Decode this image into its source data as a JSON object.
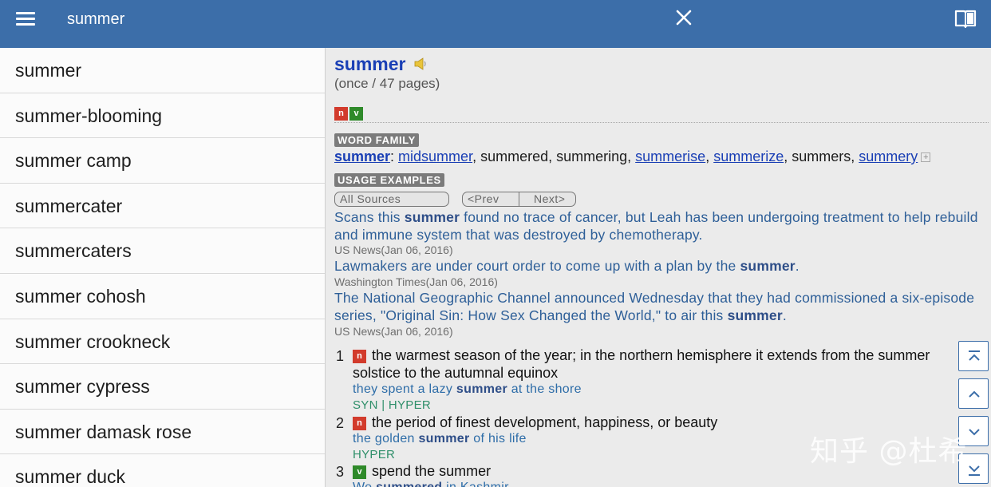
{
  "search": {
    "query": "summer"
  },
  "word_list": [
    "summer",
    "summer-blooming",
    "summer camp",
    "summercater",
    "summercaters",
    "summer cohosh",
    "summer crookneck",
    "summer cypress",
    "summer damask rose",
    "summer duck"
  ],
  "entry": {
    "headword": "summer",
    "frequency": "(once / 47 pages)",
    "pos_badges": [
      "n",
      "v"
    ],
    "word_family_label": "WORD FAMILY",
    "word_family": {
      "head": "summer",
      "items": [
        "midsummer",
        "summered",
        "summering",
        "summerise",
        "summerize",
        "summers",
        "summery"
      ]
    },
    "usage_label": "USAGE EXAMPLES",
    "source_select": "All Sources",
    "prev_label": "<Prev",
    "next_label": "Next>",
    "examples": [
      {
        "pre": "Scans this ",
        "word": "summer",
        "post": " found no trace of cancer, but Leah has been undergoing treatment to help rebuild and immune system that was destroyed by chemotherapy.",
        "source": "US News(Jan 06, 2016)"
      },
      {
        "pre": "Lawmakers are under court order to come up with a plan by the ",
        "word": "summer",
        "post": ".",
        "source": "Washington Times(Jan 06, 2016)"
      },
      {
        "pre": "The National Geographic Channel announced Wednesday that they had commissioned a six-episode series, \"Original Sin: How Sex Changed the World,\" to air this ",
        "word": "summer",
        "post": ".",
        "source": "US News(Jan 06, 2016)"
      }
    ],
    "senses": [
      {
        "num": "1",
        "pos": "n",
        "gloss": "the warmest season of the year; in the northern hemisphere it extends from the summer solstice to the autumnal equinox",
        "ex_pre": "they spent a lazy ",
        "ex_word": "summer",
        "ex_post": " at the shore",
        "rel": "SYN | HYPER"
      },
      {
        "num": "2",
        "pos": "n",
        "gloss": "the period of finest development, happiness, or beauty",
        "ex_pre": "the golden ",
        "ex_word": "summer",
        "ex_post": " of his life",
        "rel": "HYPER"
      },
      {
        "num": "3",
        "pos": "v",
        "gloss": "spend the summer",
        "ex_pre": "We ",
        "ex_word": "summered",
        "ex_post": " in Kashmir",
        "rel": ""
      }
    ]
  },
  "watermark": "知乎 @杜希"
}
